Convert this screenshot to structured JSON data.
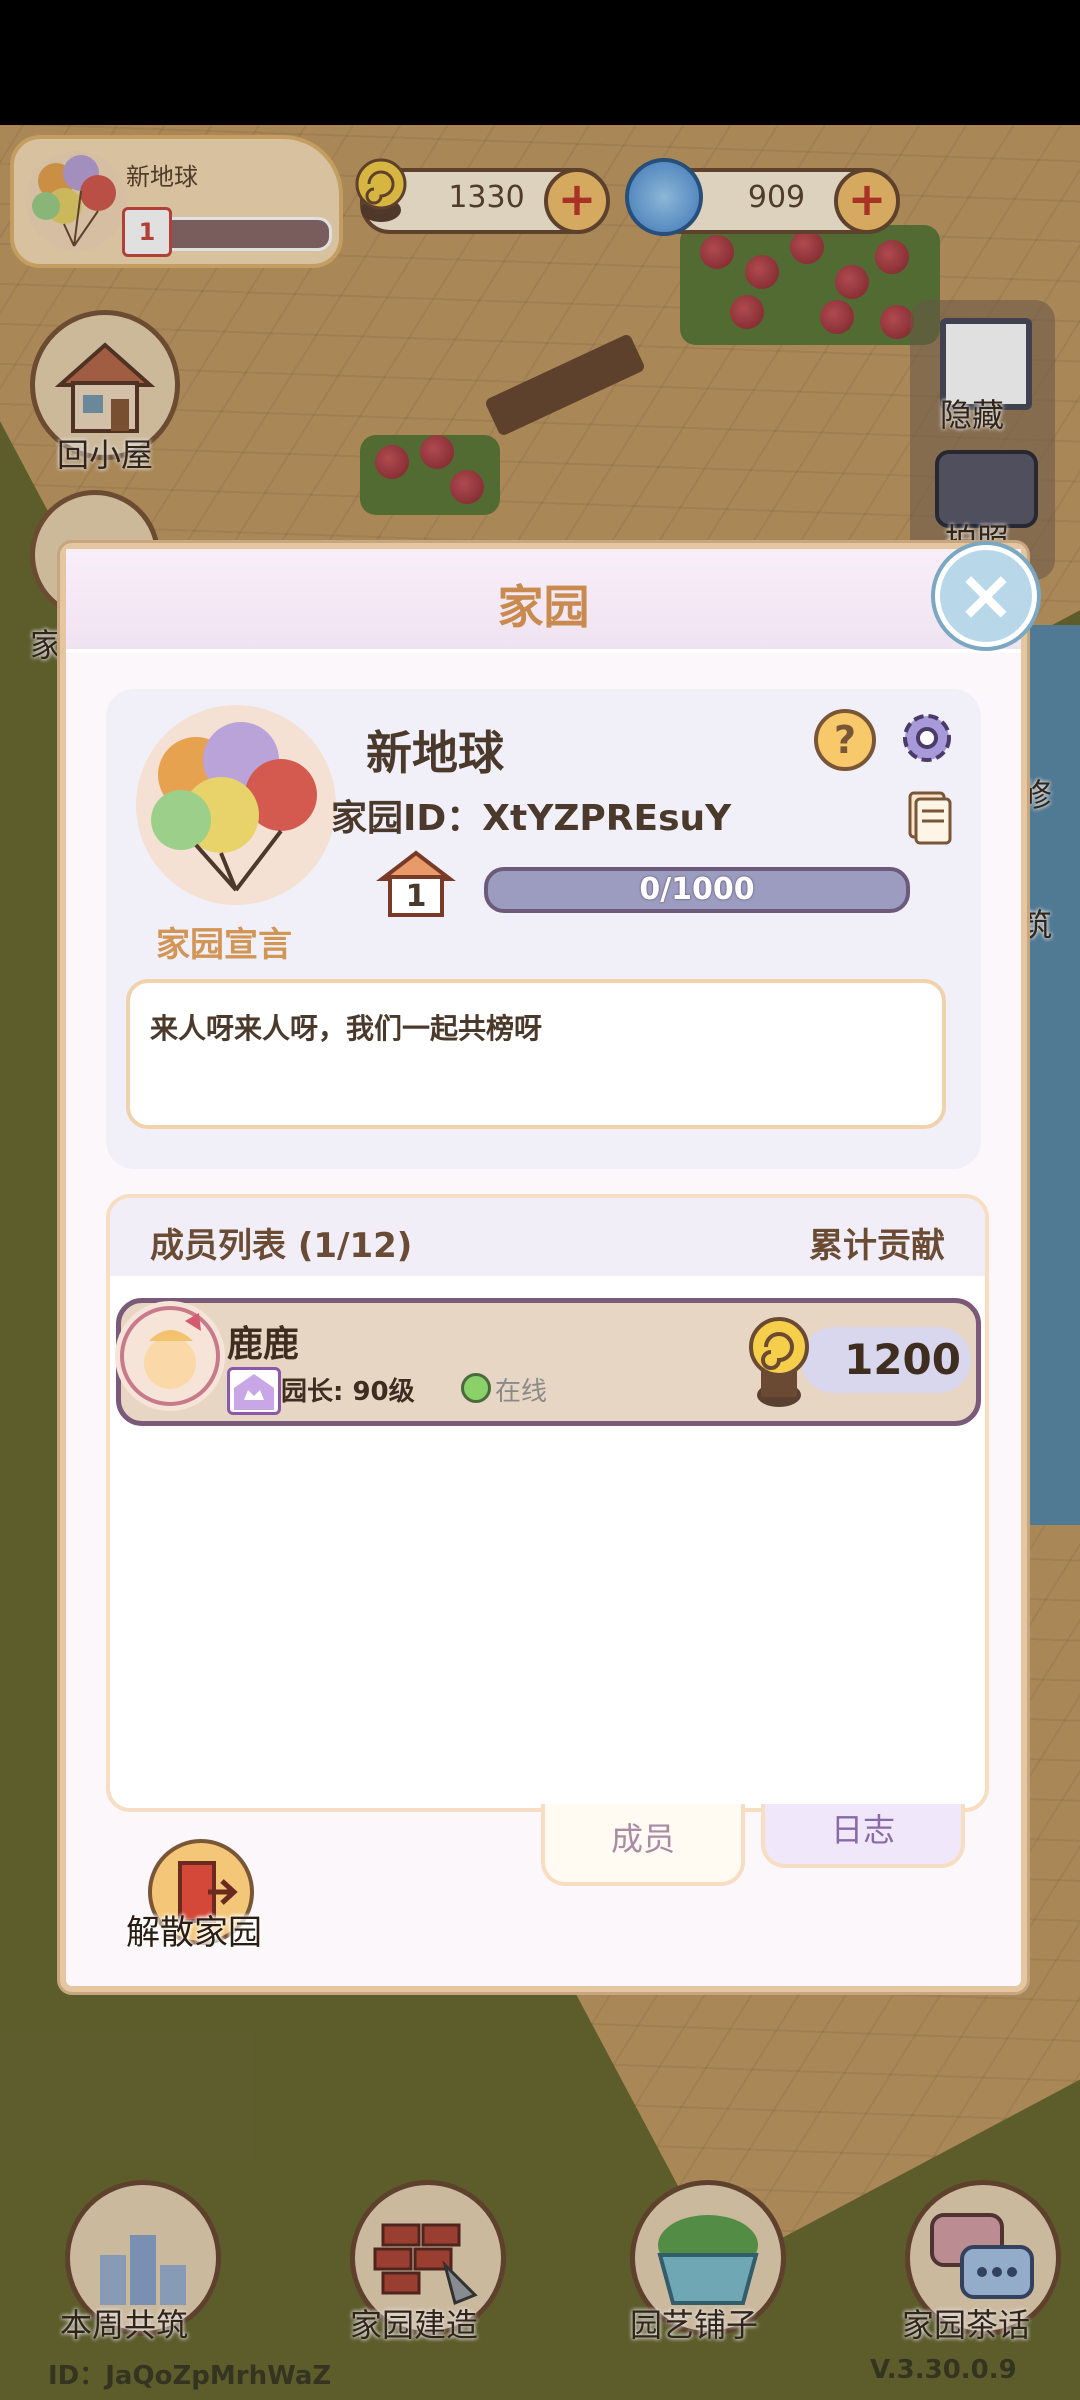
{
  "profile": {
    "name": "新地球",
    "level": "1"
  },
  "currency": {
    "snail_coins": "1330",
    "swirl_gems": "909"
  },
  "side_buttons": {
    "home_cabin": "回小屋",
    "garden_short": "家",
    "hide": "隐藏",
    "photo": "拍照",
    "repair_short": "修",
    "build_short": "筑"
  },
  "dialog": {
    "title": "家园",
    "garden_name": "新地球",
    "garden_id_label": "家园ID：",
    "garden_id_value": "XtYZPREsuY",
    "house_level": "1",
    "exp": "0/1000",
    "exp_fraction": 0.0,
    "declaration_label": "家园宣言",
    "declaration_text": "来人呀来人呀，我们一起共榜呀",
    "member_list_title": "成员列表 (1/12)",
    "contribution_title": "累计贡献",
    "members": [
      {
        "name": "鹿鹿",
        "role": "园长: 90级",
        "status": "在线",
        "contribution": "1200"
      }
    ],
    "tabs": [
      "成员",
      "日志"
    ],
    "disband": "解散家园"
  },
  "bottom_bar": {
    "weekly_build": "本周共筑",
    "garden_build": "家园建造",
    "gardening_shop": "园艺铺子",
    "garden_chat": "家园茶话"
  },
  "footer": {
    "user_id": "ID：JaQoZpMrhWaZ",
    "version": "V.3.30.0.9"
  },
  "colors": {
    "dialog_bg": "#fbf7fa",
    "accent_title": "#c88a4e",
    "member_row_border": "#7a5a78"
  }
}
